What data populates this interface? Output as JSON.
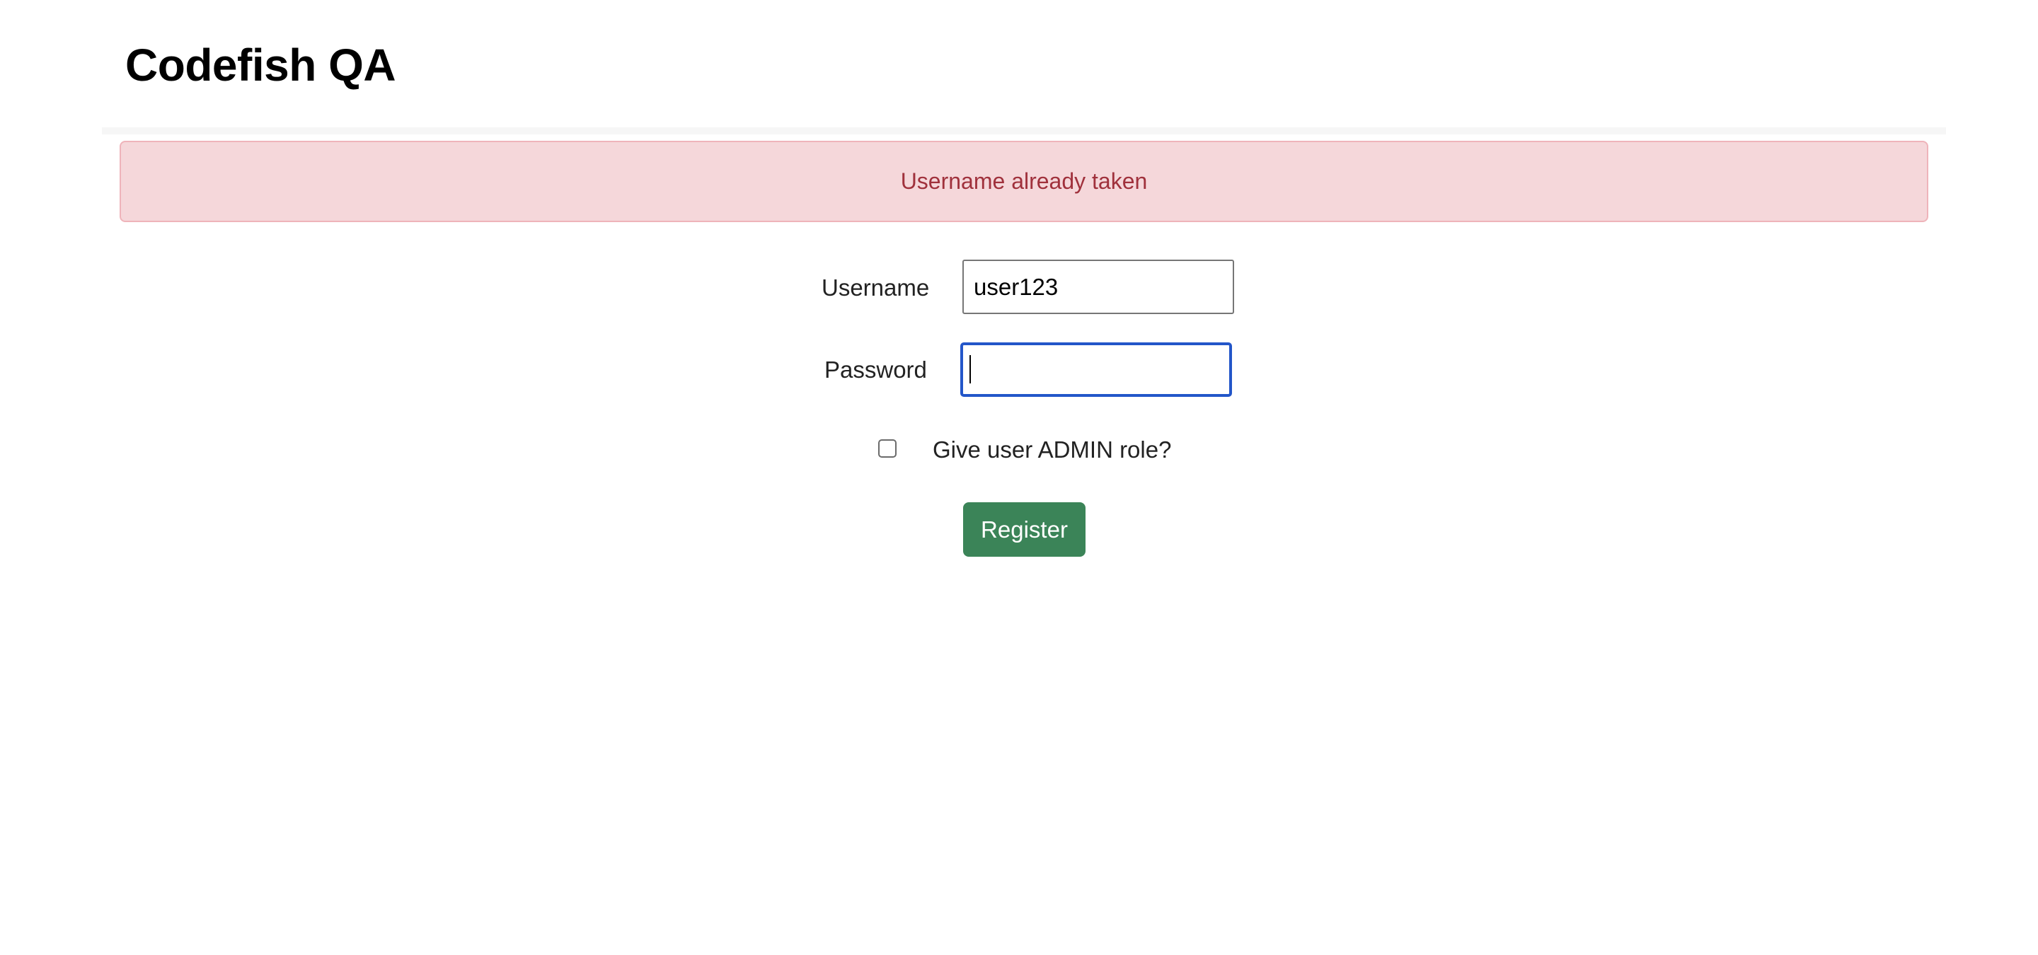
{
  "header": {
    "title": "Codefish QA"
  },
  "alert": {
    "message": "Username already taken",
    "background_color": "#f5d7da",
    "text_color": "#a0313c"
  },
  "form": {
    "username": {
      "label": "Username",
      "value": "user123"
    },
    "password": {
      "label": "Password",
      "value": ""
    },
    "admin_role": {
      "label": "Give user ADMIN role?",
      "checked": false
    },
    "submit_label": "Register",
    "submit_color": "#3b8458",
    "focus_color": "#2356c9"
  }
}
